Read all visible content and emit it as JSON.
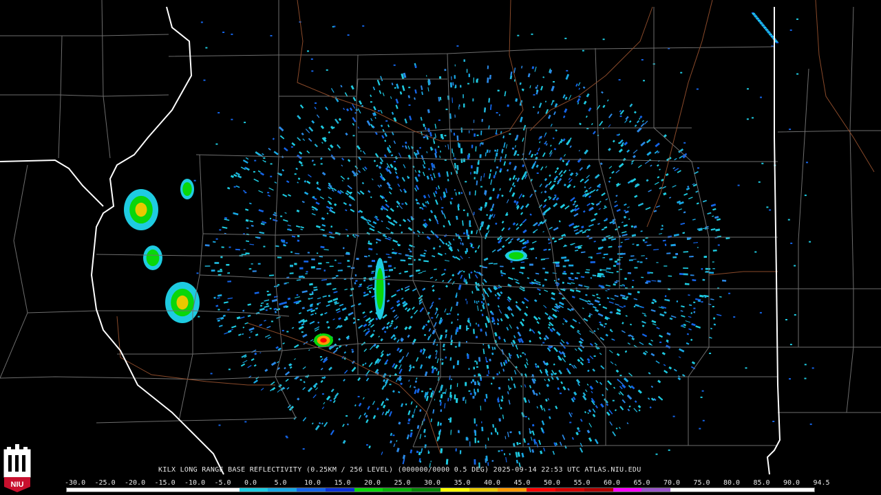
{
  "product": {
    "caption": "KILX LONG RANGE BASE REFLECTIVITY (0.25KM / 256 LEVEL) (000000/0000 0.5 DEG) 2025-09-14 22:53 UTC  ATLAS.NIU.EDU"
  },
  "logo": {
    "text": "NIU",
    "color": "#c8102e"
  },
  "colorscale": {
    "labels": [
      "-30.0",
      "-25.0",
      "-20.0",
      "-15.0",
      "-10.0",
      "-5.0",
      "0.0",
      "5.0",
      "10.0",
      "15.0",
      "20.0",
      "25.0",
      "30.0",
      "35.0",
      "40.0",
      "45.0",
      "50.0",
      "55.0",
      "60.0",
      "65.0",
      "70.0",
      "75.0",
      "80.0",
      "85.0",
      "90.0",
      "94.5"
    ],
    "colors": [
      "#ffffff",
      "#ffffff",
      "#ffffff",
      "#ffffff",
      "#ffffff",
      "#ffffff",
      "#1ecbe1",
      "#18a8e4",
      "#1464e8",
      "#0a32d8",
      "#0ad60a",
      "#09b209",
      "#088808",
      "#ffff00",
      "#e8c800",
      "#ff9a00",
      "#ff0000",
      "#d40000",
      "#b00000",
      "#ff00ff",
      "#9955c9",
      "#ffffff",
      "#ffffff",
      "#ffffff",
      "#ffffff",
      "#ffffff"
    ]
  }
}
